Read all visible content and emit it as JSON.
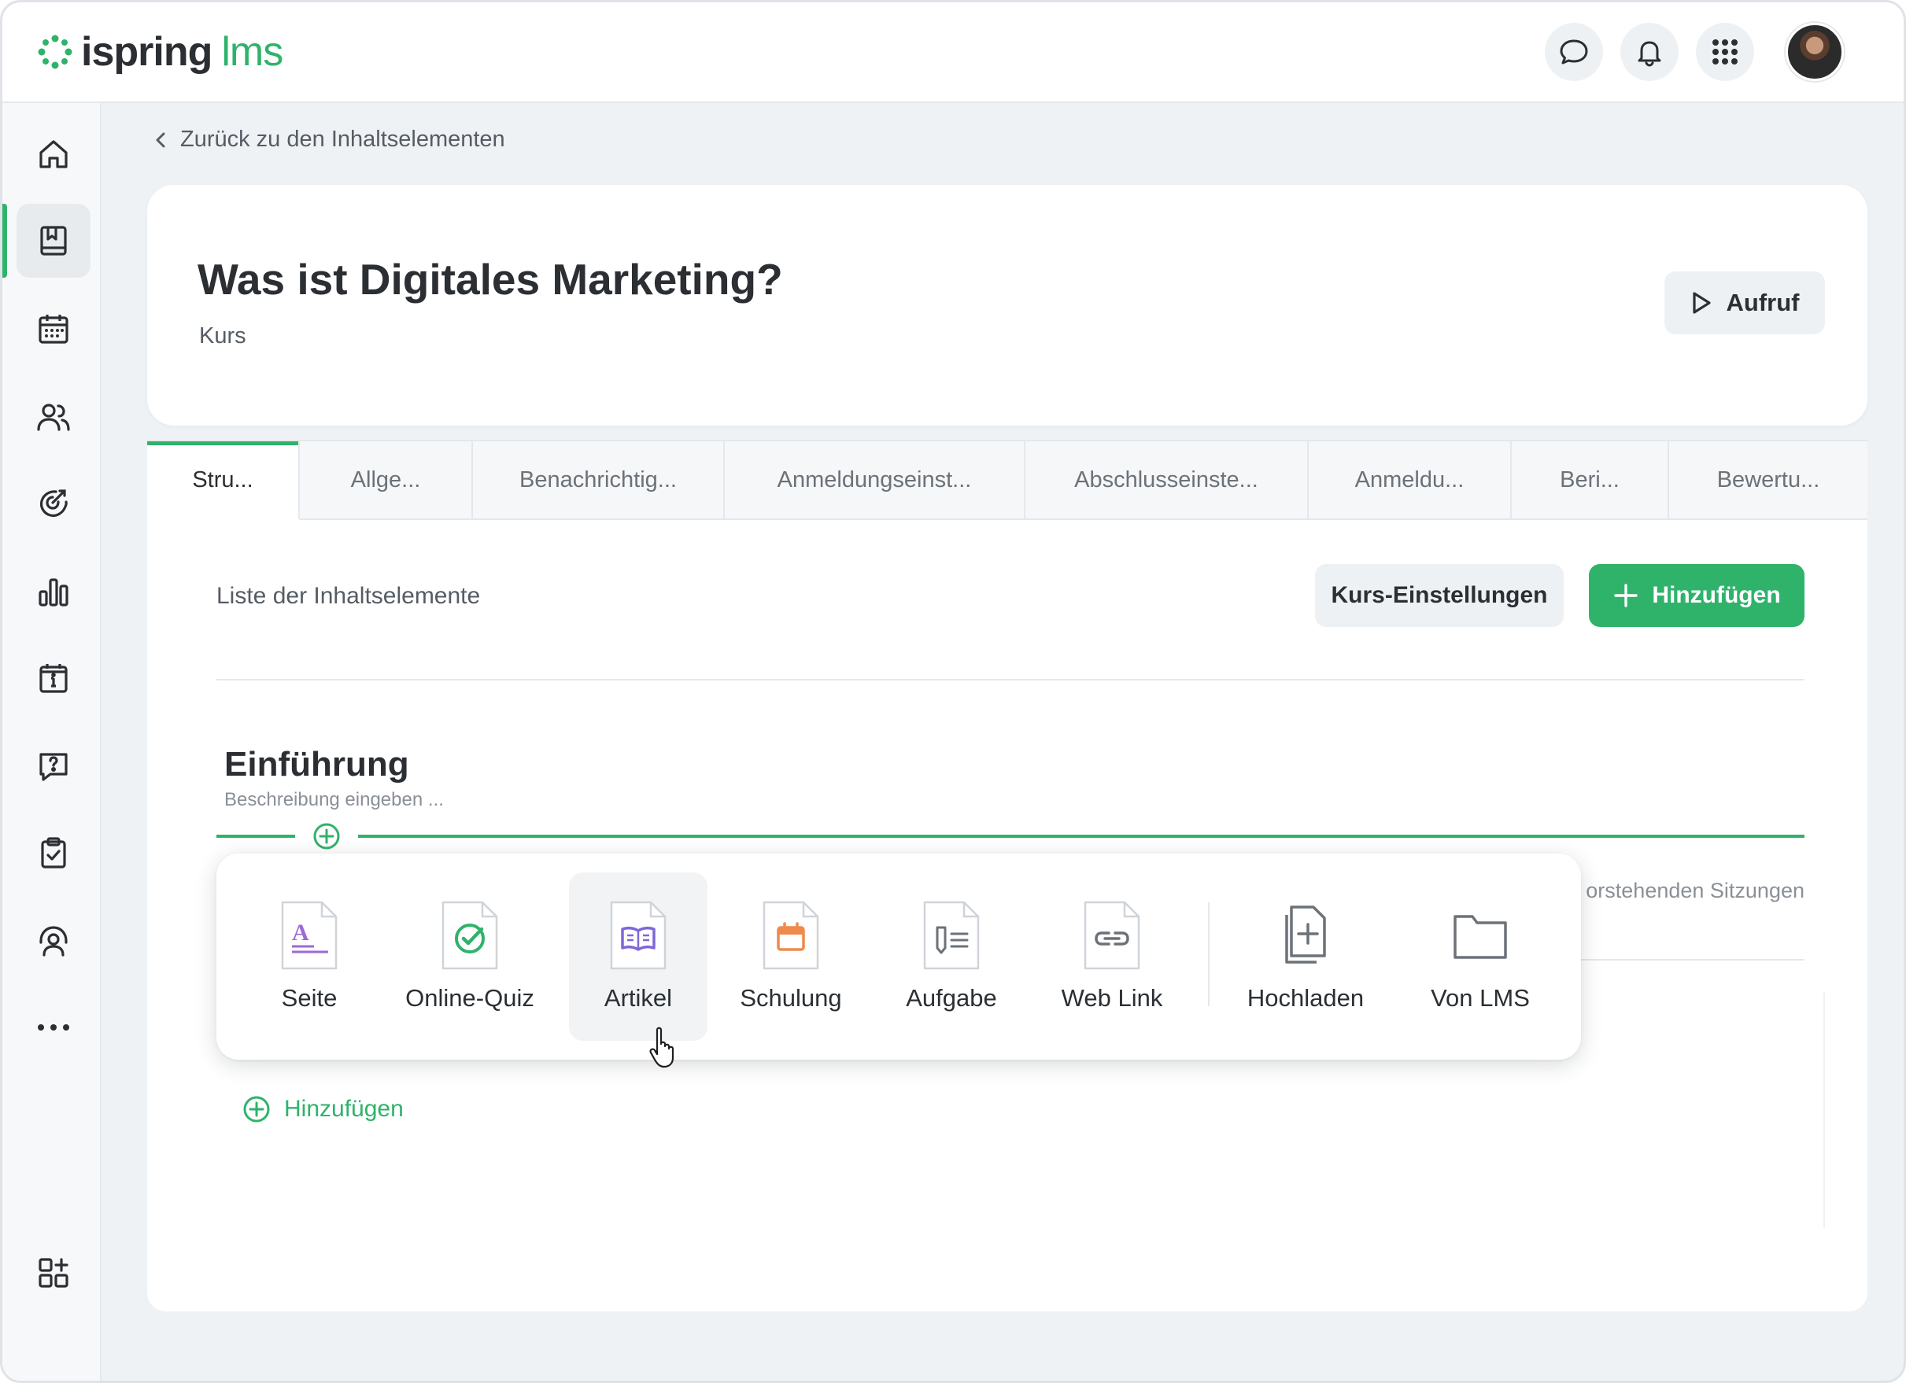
{
  "app": {
    "logo_word": "ispring",
    "logo_suffix": "lms",
    "accent_color": "#2fb36b"
  },
  "topbar": {
    "icons": [
      "chat-icon",
      "bell-icon",
      "apps-grid-icon"
    ],
    "avatar_alt": "User avatar"
  },
  "sidebar": {
    "items": [
      {
        "name": "home-icon"
      },
      {
        "name": "content-library-icon",
        "active": true
      },
      {
        "name": "calendar-icon"
      },
      {
        "name": "users-icon"
      },
      {
        "name": "goals-icon"
      },
      {
        "name": "reports-icon"
      },
      {
        "name": "info-icon"
      },
      {
        "name": "help-icon"
      },
      {
        "name": "tasks-icon"
      },
      {
        "name": "support-icon"
      },
      {
        "name": "more-icon"
      },
      {
        "name": "add-widget-icon"
      }
    ]
  },
  "breadcrumb": {
    "back_label": "Zurück zu den Inhaltselementen"
  },
  "course": {
    "title": "Was ist Digitales Marketing?",
    "type": "Kurs",
    "launch_label": "Aufruf"
  },
  "tabs": [
    {
      "label": "Stru...",
      "active": true
    },
    {
      "label": "Allge..."
    },
    {
      "label": "Benachrichtig..."
    },
    {
      "label": "Anmeldungseinst..."
    },
    {
      "label": "Abschlusseinste..."
    },
    {
      "label": "Anmeldu..."
    },
    {
      "label": "Beri..."
    },
    {
      "label": "Bewertu..."
    }
  ],
  "structure": {
    "list_title": "Liste der Inhaltselemente",
    "settings_label": "Kurs-Einstellungen",
    "add_label": "Hinzufügen",
    "section": {
      "title": "Einführung",
      "description_placeholder": "Beschreibung eingeben ..."
    },
    "behind_popup_text": "orstehenden Sitzungen",
    "add_link_label": "Hinzufügen"
  },
  "add_menu": {
    "items": [
      {
        "label": "Seite",
        "icon": "page-icon"
      },
      {
        "label": "Online-Quiz",
        "icon": "quiz-icon"
      },
      {
        "label": "Artikel",
        "icon": "article-icon",
        "hovered": true
      },
      {
        "label": "Schulung",
        "icon": "training-icon"
      },
      {
        "label": "Aufgabe",
        "icon": "assignment-icon"
      },
      {
        "label": "Web Link",
        "icon": "web-link-icon"
      },
      {
        "label": "Hochladen",
        "icon": "upload-icon"
      },
      {
        "label": "Von LMS",
        "icon": "folder-icon"
      }
    ]
  }
}
